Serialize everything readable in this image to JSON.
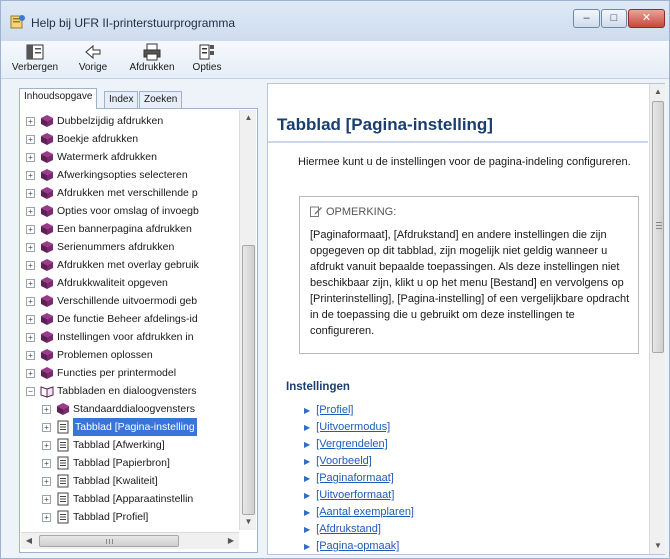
{
  "window": {
    "title": "Help bij UFR II-printerstuurprogramma",
    "controls": {
      "minimize": "–",
      "maximize": "□",
      "close": "✕"
    }
  },
  "toolbar": {
    "hide_label": "Verbergen",
    "back_label": "Vorige",
    "print_label": "Afdrukken",
    "options_label": "Opties"
  },
  "nav": {
    "tabs": [
      "Inhoudsopgave",
      "Index",
      "Zoeken"
    ],
    "tree": [
      {
        "label": "Dubbelzijdig afdrukken",
        "level": 0,
        "expander": "+",
        "icon": "book-icon"
      },
      {
        "label": "Boekje afdrukken",
        "level": 0,
        "expander": "+",
        "icon": "book-icon"
      },
      {
        "label": "Watermerk afdrukken",
        "level": 0,
        "expander": "+",
        "icon": "book-icon"
      },
      {
        "label": "Afwerkingsopties selecteren",
        "level": 0,
        "expander": "+",
        "icon": "book-icon"
      },
      {
        "label": "Afdrukken met verschillende p",
        "level": 0,
        "expander": "+",
        "icon": "book-icon"
      },
      {
        "label": "Opties voor omslag of invoegb",
        "level": 0,
        "expander": "+",
        "icon": "book-icon"
      },
      {
        "label": "Een bannerpagina afdrukken",
        "level": 0,
        "expander": "+",
        "icon": "book-icon"
      },
      {
        "label": "Serienummers afdrukken",
        "level": 0,
        "expander": "+",
        "icon": "book-icon"
      },
      {
        "label": "Afdrukken met overlay gebruik",
        "level": 0,
        "expander": "+",
        "icon": "book-icon"
      },
      {
        "label": "Afdrukkwaliteit opgeven",
        "level": 0,
        "expander": "+",
        "icon": "book-icon"
      },
      {
        "label": "Verschillende uitvoermodi geb",
        "level": 0,
        "expander": "+",
        "icon": "book-icon"
      },
      {
        "label": "De functie Beheer afdelings-id",
        "level": 0,
        "expander": "+",
        "icon": "book-icon"
      },
      {
        "label": "Instellingen voor afdrukken in",
        "level": 0,
        "expander": "+",
        "icon": "book-icon"
      },
      {
        "label": "Problemen oplossen",
        "level": 0,
        "expander": "+",
        "icon": "book-icon"
      },
      {
        "label": "Functies per printermodel",
        "level": 0,
        "expander": "+",
        "icon": "book-icon"
      },
      {
        "label": "Tabbladen en dialoogvensters",
        "level": 0,
        "expander": "−",
        "icon": "open-book-icon"
      },
      {
        "label": "Standaarddialoogvensters",
        "level": 1,
        "expander": "+",
        "icon": "book-icon"
      },
      {
        "label": "Tabblad [Pagina-instelling",
        "level": 1,
        "expander": "+",
        "icon": "page-icon",
        "selected": true
      },
      {
        "label": "Tabblad [Afwerking]",
        "level": 1,
        "expander": "+",
        "icon": "page-icon"
      },
      {
        "label": "Tabblad [Papierbron]",
        "level": 1,
        "expander": "+",
        "icon": "page-icon"
      },
      {
        "label": "Tabblad [Kwaliteit]",
        "level": 1,
        "expander": "+",
        "icon": "page-icon"
      },
      {
        "label": "Tabblad [Apparaatinstellin",
        "level": 1,
        "expander": "+",
        "icon": "page-icon"
      },
      {
        "label": "Tabblad [Profiel]",
        "level": 1,
        "expander": "+",
        "icon": "page-icon"
      }
    ]
  },
  "content": {
    "title": "Tabblad [Pagina-instelling]",
    "intro": "Hiermee kunt u de instellingen voor de pagina-indeling configureren.",
    "note": {
      "heading": "OPMERKING:",
      "body": "[Paginaformaat], [Afdrukstand] en andere instellingen die zijn opgegeven op dit tabblad, zijn mogelijk niet geldig wanneer u afdrukt vanuit bepaalde toepassingen. Als deze instellingen niet beschikbaar zijn, klikt u op het menu [Bestand] en vervolgens op [Printerinstelling], [Pagina-instelling] of een vergelijkbare opdracht in de toepassing die u gebruikt om deze instellingen te configureren."
    },
    "section_heading": "Instellingen",
    "links": [
      "[Profiel]",
      "[Uitvoermodus]",
      "[Vergrendelen]",
      "[Voorbeeld]",
      "[Paginaformaat]",
      "[Uitvoerformaat]",
      "[Aantal exemplaren]",
      "[Afdrukstand]",
      "[Pagina-opmaak]"
    ]
  },
  "colors": {
    "title_text": "#1a3f6e",
    "link": "#1f5bb8",
    "selection": "#3875d7",
    "book_icon": "#7a2a6e"
  }
}
